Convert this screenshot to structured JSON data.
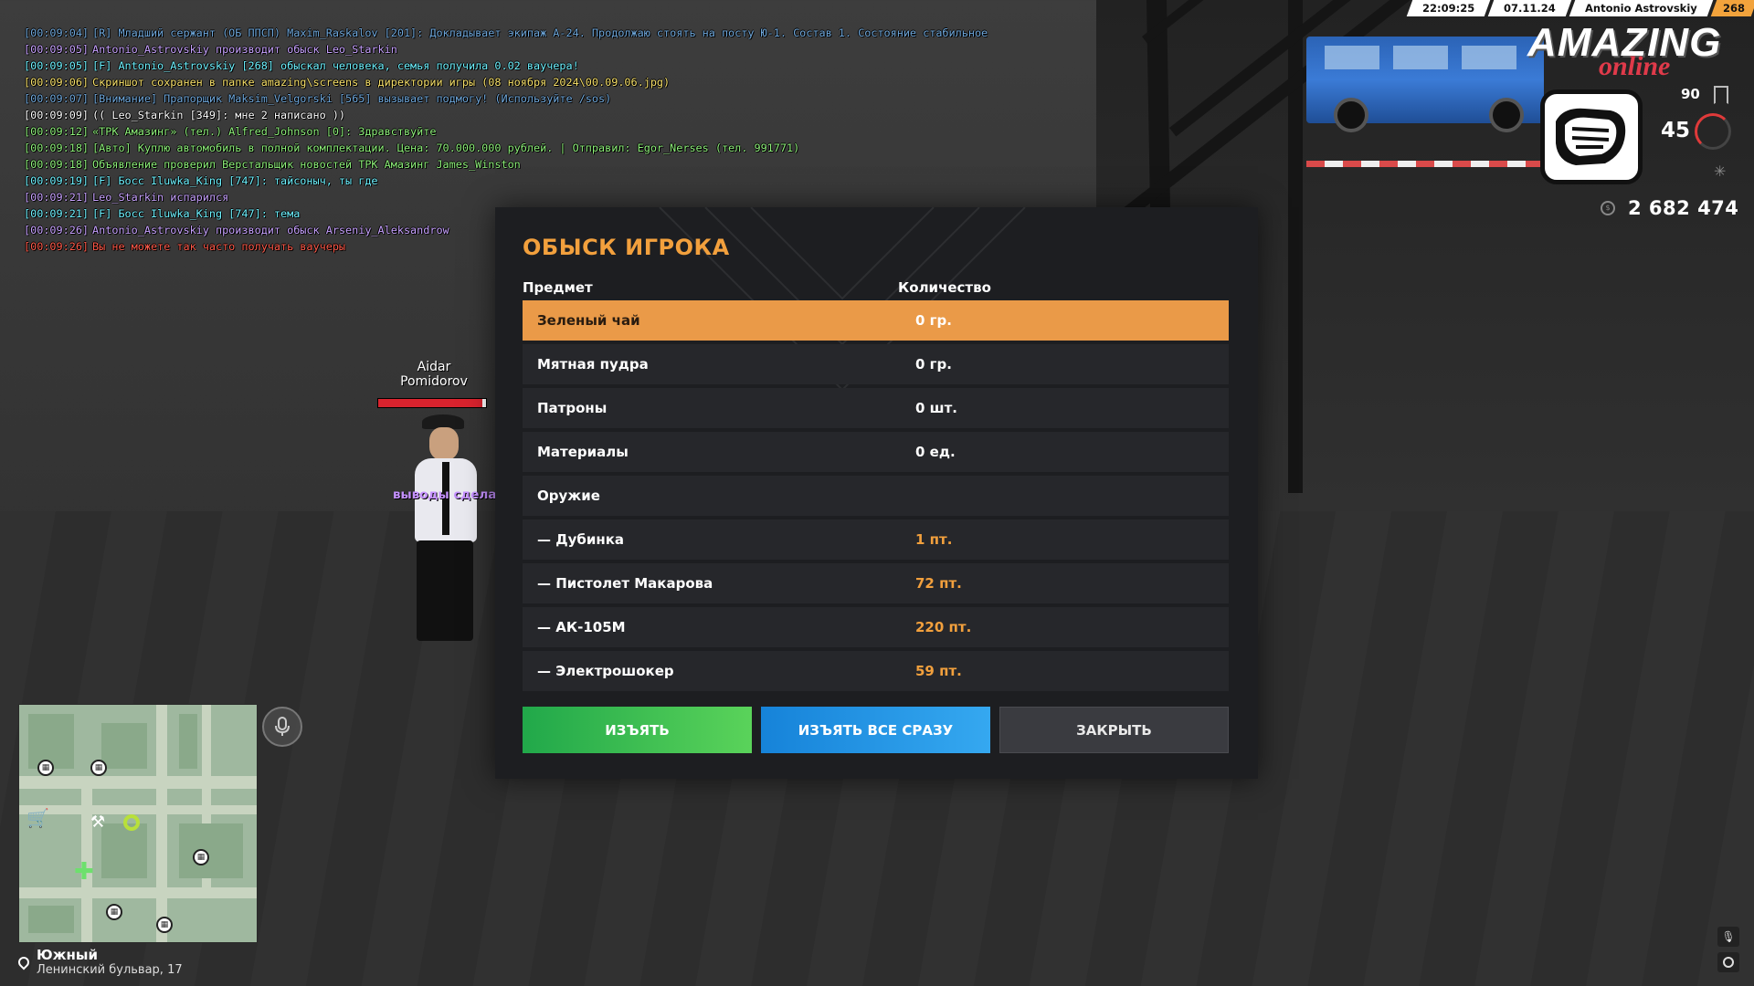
{
  "chat": [
    {
      "time": "[00:09:04]",
      "text": "[R] Младший сержант (ОБ ППСП) Maxim_Raskalov [201]: Докладывает экипаж А-24. Продолжаю стоять на посту Ю-1. Состав 1. Состояние стабильное",
      "color": "#6fa8dc"
    },
    {
      "time": "[00:09:05]",
      "text": "Antonio_Astrovskiy производит обыск Leo_Starkin",
      "color": "#c8a2ff"
    },
    {
      "time": "[00:09:05]",
      "text": "[F] Antonio_Astrovskiy [268] обыскал человека, семья получила 0.02 ваучера!",
      "color": "#6ef2ff"
    },
    {
      "time": "[00:09:06]",
      "text": "Скриншот сохранен в папке amazing\\screens в директории игры (08 ноября 2024\\00.09.06.jpg)",
      "color": "#f7e06a"
    },
    {
      "time": "[00:09:07]",
      "text": "[Внимание] Прапорщик Maksim_Velgorski [565] вызывает подмогу! (Используйте /sos)",
      "color": "#6fa8dc"
    },
    {
      "time": "[00:09:09]",
      "text": "(( Leo_Starkin [349]: мне 2 написано ))",
      "color": "#ffffff"
    },
    {
      "time": "[00:09:12]",
      "text": "«ТРК Амазинг» (тел.) Alfred_Johnson [0]: Здравствуйте",
      "color": "#8ef07a"
    },
    {
      "time": "[00:09:18]",
      "text": "[Авто] Куплю автомобиль в полной комплектации. Цена: 70.000.000 рублей. | Отправил: Egor_Nerses (тел. 991771)",
      "color": "#8ef07a"
    },
    {
      "time": "[00:09:18]",
      "text": "Объявление проверил Верстальщик новостей ТРК Амазинг James_Winston",
      "color": "#8ef07a"
    },
    {
      "time": "[00:09:19]",
      "text": "[F] Босс Iluwka_King [747]: тайсоныч, ты где",
      "color": "#6ef2ff"
    },
    {
      "time": "[00:09:21]",
      "text": "Leo_Starkin испарился",
      "color": "#c8a2ff"
    },
    {
      "time": "[00:09:21]",
      "text": "[F] Босс Iluwka_King [747]: тема",
      "color": "#6ef2ff"
    },
    {
      "time": "[00:09:26]",
      "text": "Antonio_Astrovskiy производит обыск Arseniy_Aleksandrow",
      "color": "#c8a2ff"
    },
    {
      "time": "[00:09:26]",
      "text": "Вы не можете так часто получать ваучеры",
      "color": "#ff5a4a"
    }
  ],
  "hud": {
    "clock": "22:09:25",
    "date": "07.11.24",
    "player_name": "Antonio Astrovskiy",
    "player_id": "268",
    "logo_main": "AMAZING",
    "logo_sub": "online",
    "stat_top": "90",
    "stat_health": "45",
    "money": "2 682 474"
  },
  "npc": {
    "name_line1": "Aidar",
    "name_line2": "Pomidorov",
    "health_fraction": 0.97,
    "label": "выводы сдела"
  },
  "modal": {
    "title": "ОБЫСК ИГРОКА",
    "col_item": "Предмет",
    "col_qty": "Количество",
    "rows": [
      {
        "item": "Зеленый чай",
        "qty": "0 гр."
      },
      {
        "item": "Мятная пудра",
        "qty": "0 гр."
      },
      {
        "item": "Патроны",
        "qty": "0 шт."
      },
      {
        "item": "Материалы",
        "qty": "0 ед."
      },
      {
        "item": "Оружие",
        "qty": ""
      },
      {
        "item": "— Дубинка",
        "qty": "1 пт."
      },
      {
        "item": "— Пистолет Макарова",
        "qty": "72 пт."
      },
      {
        "item": "— АК-105М",
        "qty": "220 пт."
      },
      {
        "item": "— Электрошокер",
        "qty": "59 пт."
      }
    ],
    "btn_take": "ИЗЪЯТЬ",
    "btn_take_all": "ИЗЪЯТЬ ВСЕ СРАЗУ",
    "btn_close": "ЗАКРЫТЬ"
  },
  "location": {
    "district": "Южный",
    "street": "Ленинский бульвар, 17"
  },
  "colors": {
    "accent_orange": "#ea9a48",
    "title_orange": "#f2a03d",
    "green_button": "#21a84a",
    "blue_button": "#1683d9"
  }
}
